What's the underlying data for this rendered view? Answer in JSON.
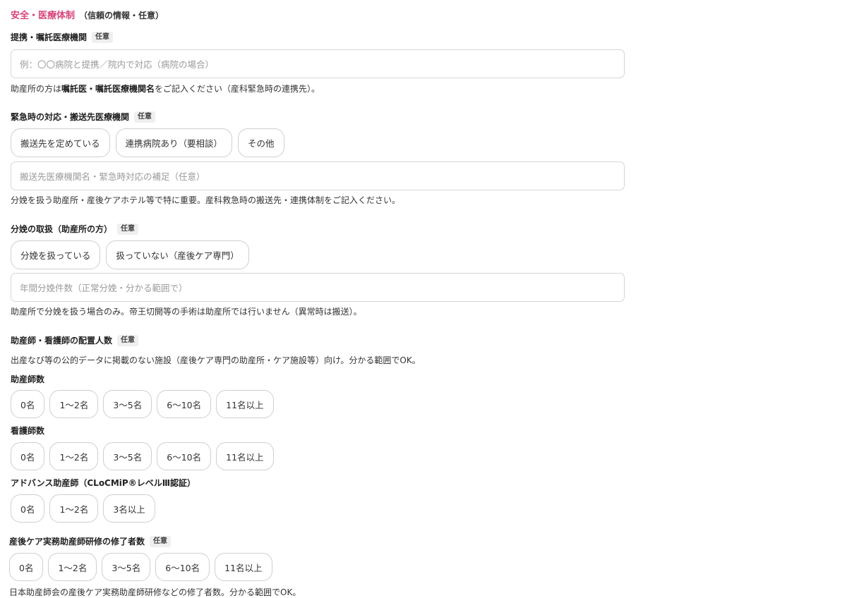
{
  "section": {
    "title": "安全・医療体制",
    "subtitle": "（信頼の情報・任意）"
  },
  "partner": {
    "label": "提携・嘱託医療機関",
    "badge": "任意",
    "placeholder": "例：〇〇病院と提携／院内で対応（病院の場合）",
    "help_pre": "助産所の方は",
    "help_bold": "嘱託医・嘱託医療機関名",
    "help_post": "をご記入ください（産科緊急時の連携先）。"
  },
  "emergency": {
    "label": "緊急時の対応・搬送先医療機関",
    "badge": "任意",
    "options": [
      "搬送先を定めている",
      "連携病院あり（要相談）",
      "その他"
    ],
    "placeholder": "搬送先医療機関名・緊急時対応の補足（任意）",
    "help": "分娩を扱う助産所・産後ケアホテル等で特に重要。産科救急時の搬送先・連携体制をご記入ください。"
  },
  "delivery": {
    "label": "分娩の取扱（助産所の方）",
    "badge": "任意",
    "options": [
      "分娩を扱っている",
      "扱っていない（産後ケア専門）"
    ],
    "placeholder": "年間分娩件数（正常分娩・分かる範囲で）",
    "help": "助産所で分娩を扱う場合のみ。帝王切開等の手術は助産所では行いません（異常時は搬送）。"
  },
  "staffing": {
    "label": "助産師・看護師の配置人数",
    "badge": "任意",
    "help": "出産なび等の公的データに掲載のない施設（産後ケア専門の助産所・ケア施設等）向け。分かる範囲でOK。",
    "midwives": {
      "label": "助産師数",
      "options": [
        "0名",
        "1〜2名",
        "3〜5名",
        "6〜10名",
        "11名以上"
      ]
    },
    "nurses": {
      "label": "看護師数",
      "options": [
        "0名",
        "1〜2名",
        "3〜5名",
        "6〜10名",
        "11名以上"
      ]
    },
    "advanced": {
      "label": "アドバンス助産師（CLoCMiP®レベルⅢ認証）",
      "options": [
        "0名",
        "1〜2名",
        "3名以上"
      ]
    }
  },
  "training": {
    "label": "産後ケア実務助産師研修の修了者数",
    "badge": "任意",
    "options": [
      "0名",
      "1〜2名",
      "3〜5名",
      "6〜10名",
      "11名以上"
    ],
    "help_partial": "日本助産師会の産後ケア実務助産師研修などの修了者数。分かる範囲でOK。"
  }
}
